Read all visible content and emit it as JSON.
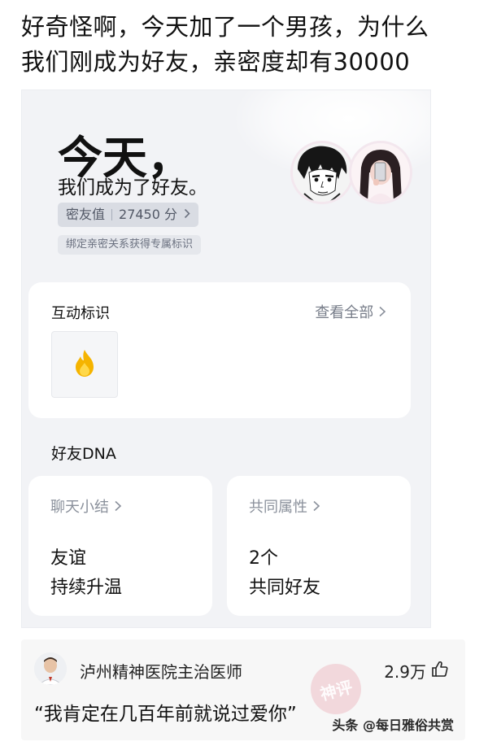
{
  "post": {
    "title_line1": "好奇怪啊，今天加了一个男孩，为什么",
    "title_line2": "我们刚成为好友，亲密度却有30000"
  },
  "screenshot": {
    "headline_big": "今天，",
    "headline_sub": "我们成为了好友。",
    "score_label": "密友值",
    "score_value": "27450 分",
    "hint": "绑定亲密关系获得专属标识",
    "interaction": {
      "title": "互动标识",
      "see_all": "查看全部",
      "badge_icon": "flame-icon"
    },
    "dna": {
      "title": "好友DNA",
      "chat": {
        "label": "聊天小结",
        "value_line1": "友谊",
        "value_line2": "持续升温"
      },
      "common": {
        "label": "共同属性",
        "value_line1": "2个",
        "value_line2": "共同好友"
      }
    }
  },
  "comment": {
    "author": "泸州精神医院主治医师",
    "likes": "2.9万",
    "text": "“我肯定在几百年前就说过爱你”",
    "stamp": "神评"
  },
  "watermark": "头条 @每日雅俗共赏",
  "colors": {
    "flame": "#f5b400",
    "page_bg": "#f2f3f6",
    "card": "#ffffff"
  }
}
